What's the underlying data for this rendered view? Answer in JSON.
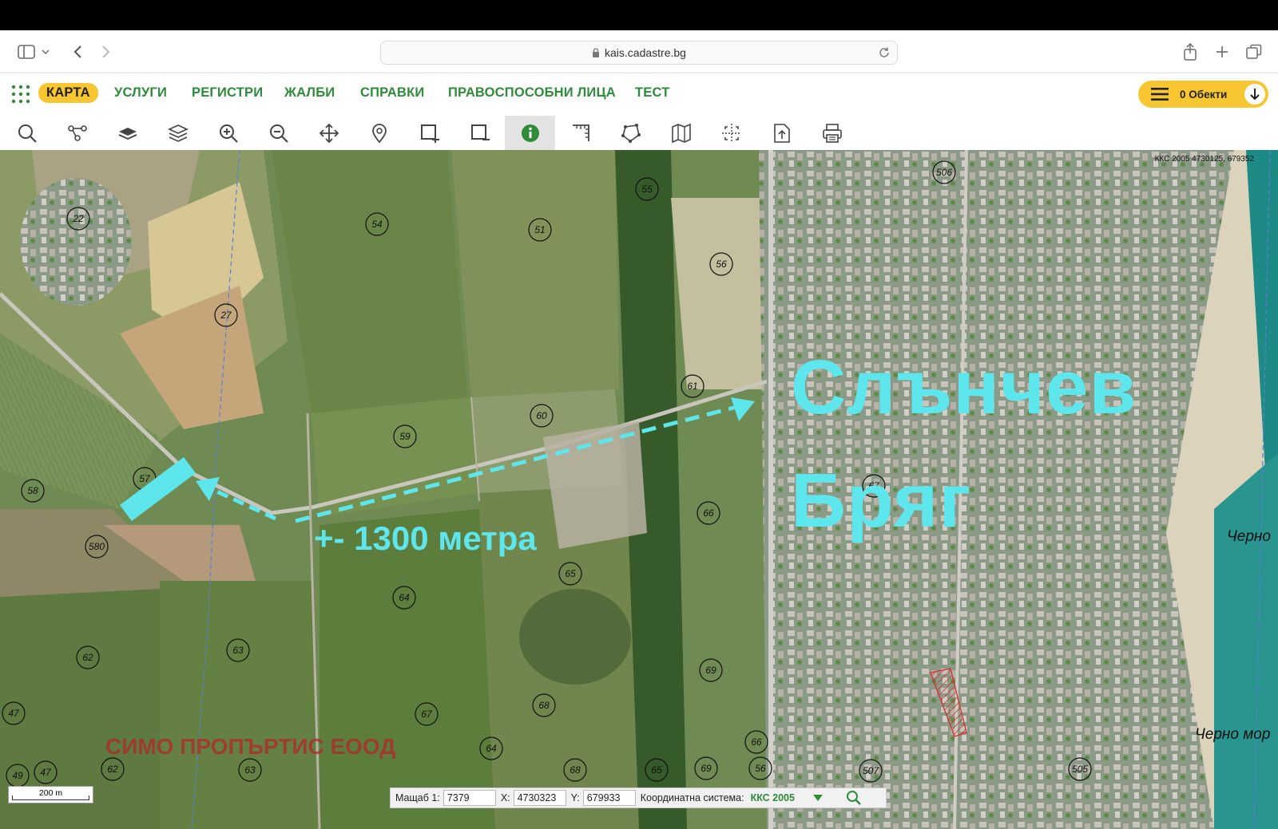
{
  "browser": {
    "url": "kais.cadastre.bg"
  },
  "nav": {
    "items": [
      "КАРТА",
      "УСЛУГИ",
      "РЕГИСТРИ",
      "ЖАЛБИ",
      "СПРАВКИ",
      "ПРАВОСПОСОБНИ ЛИЦА",
      "ТЕСТ"
    ],
    "objects_label": "0 Обекти"
  },
  "toolbar": {
    "tools": [
      "search-icon",
      "route-icon",
      "layers-flat-icon",
      "layers-icon",
      "zoom-in-icon",
      "zoom-out-icon",
      "pan-icon",
      "pin-icon",
      "select-rect-icon",
      "deselect-rect-icon",
      "info-icon",
      "measure-icon",
      "polygon-icon",
      "map-icon",
      "crosshair-icon",
      "export-icon",
      "print-icon"
    ],
    "active_tool": "info-icon"
  },
  "map": {
    "coord_readout": "ККС 2005 4730125, 679352",
    "title_line1": "Слънчев",
    "title_line2": "Бряг",
    "distance_label": "+- 1300 метра",
    "company_label": "СИМО ПРОПЪРТИС ЕООД",
    "sea_label_1": "Черно",
    "sea_label_2": "Черно мор",
    "accent_color": "#5de6ec",
    "parcel_labels": [
      "22",
      "54",
      "51",
      "55",
      "506",
      "27",
      "56",
      "61",
      "60",
      "59",
      "57",
      "58",
      "580",
      "66",
      "67",
      "65",
      "64",
      "62",
      "63",
      "69",
      "68",
      "66",
      "47",
      "49",
      "47",
      "62",
      "63",
      "67",
      "64",
      "68",
      "65",
      "69",
      "56",
      "507",
      "505"
    ],
    "scale_label": "200 m"
  },
  "status": {
    "scale_label": "Мащаб 1:",
    "scale_value": "7379",
    "x_label": "X:",
    "x_value": "4730323",
    "y_label": "Y:",
    "y_value": "679933",
    "crs_label": "Координатна система:",
    "crs_value": "ККС 2005"
  }
}
